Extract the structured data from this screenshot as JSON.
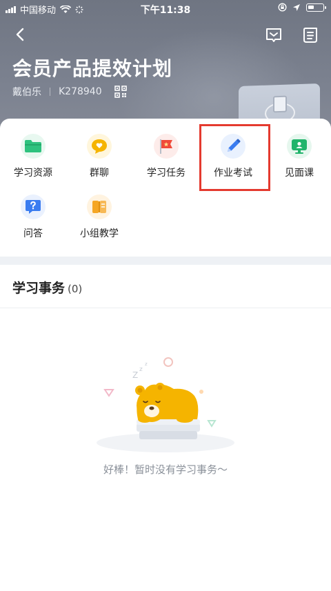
{
  "status_bar": {
    "carrier": "中国移动",
    "time": "下午11:38"
  },
  "header": {
    "title": "会员产品提效计划",
    "teacher": "戴伯乐",
    "code": "K278940"
  },
  "features": [
    {
      "label": "学习资源",
      "icon": "folder-icon",
      "color": "#2ec27e"
    },
    {
      "label": "群聊",
      "icon": "chat-heart-icon",
      "color": "#f5b400"
    },
    {
      "label": "学习任务",
      "icon": "flag-icon",
      "color": "#f04b3a"
    },
    {
      "label": "作业考试",
      "icon": "pencil-icon",
      "color": "#3a7cf0"
    },
    {
      "label": "见面课",
      "icon": "monitor-icon",
      "color": "#21b46b"
    },
    {
      "label": "问答",
      "icon": "question-bubble-icon",
      "color": "#3a7cf0"
    },
    {
      "label": "小组教学",
      "icon": "book-group-icon",
      "color": "#f5a623"
    }
  ],
  "section": {
    "title": "学习事务",
    "count": "(0)"
  },
  "empty_state": {
    "message": "好棒！暂时没有学习事务～"
  }
}
